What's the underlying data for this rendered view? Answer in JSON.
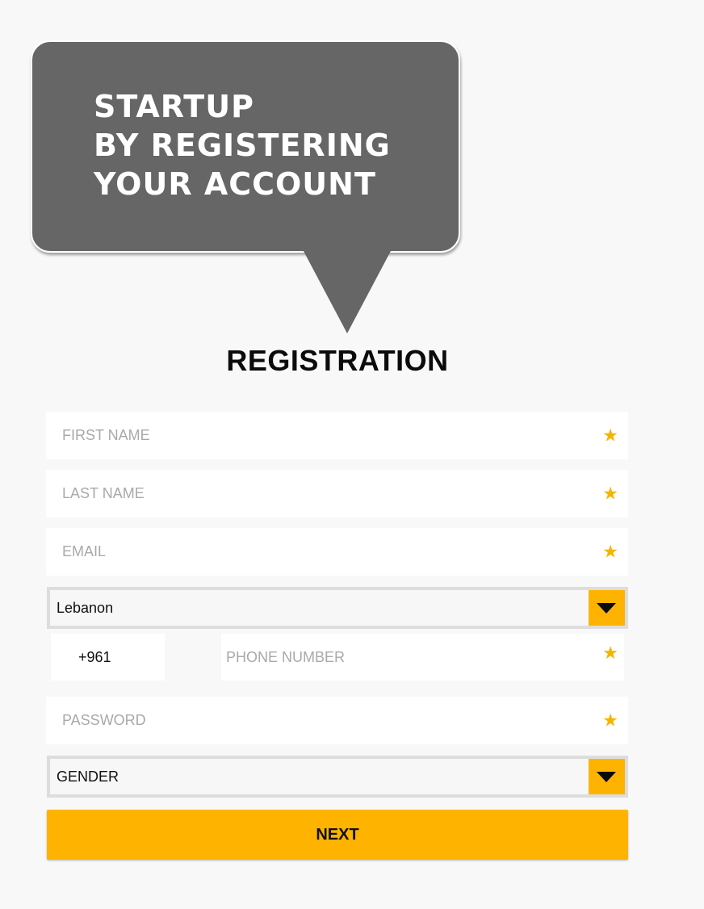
{
  "banner": {
    "lines": [
      "STARTUP",
      "BY REGISTERING",
      "YOUR ACCOUNT"
    ]
  },
  "heading": "REGISTRATION",
  "form": {
    "first_name": {
      "placeholder": "FIRST NAME",
      "value": "",
      "required_mark": "★"
    },
    "last_name": {
      "placeholder": "LAST NAME",
      "value": "",
      "required_mark": "★"
    },
    "email": {
      "placeholder": "EMAIL",
      "value": "",
      "required_mark": "★"
    },
    "country": {
      "selected": "Lebanon",
      "icon": "chevron-down-icon"
    },
    "phone_code": "+961",
    "phone": {
      "placeholder": "PHONE NUMBER",
      "value": "",
      "required_mark": "★"
    },
    "password": {
      "placeholder": "PASSWORD",
      "value": "",
      "required_mark": "★"
    },
    "gender": {
      "selected": "GENDER",
      "icon": "chevron-down-icon"
    },
    "next_label": "NEXT"
  },
  "colors": {
    "accent": "#fdb300",
    "bubble": "#666666",
    "background": "#f8f8f8",
    "star": "#f5b400"
  }
}
